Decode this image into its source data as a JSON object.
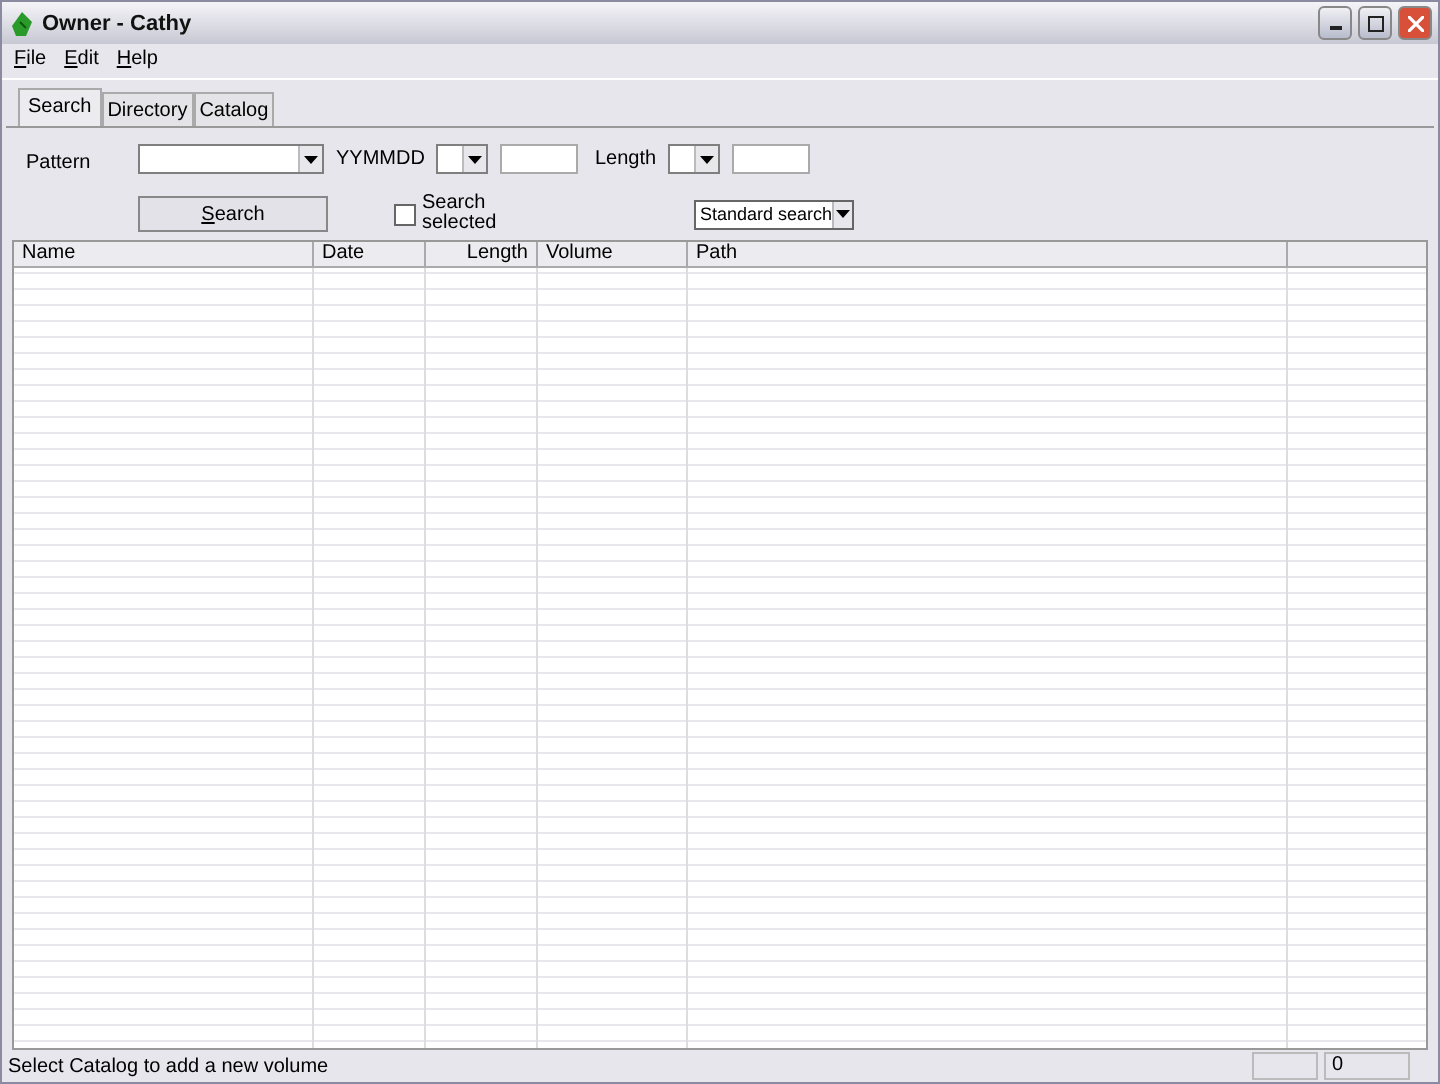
{
  "window": {
    "title": "Owner - Cathy"
  },
  "menu": [
    "File",
    "Edit",
    "Help"
  ],
  "tabs": [
    {
      "label": "Search",
      "selected": true
    },
    {
      "label": "Directory",
      "selected": false
    },
    {
      "label": "Catalog",
      "selected": false
    }
  ],
  "form": {
    "pattern_label": "Pattern",
    "date_label": "YYMMDD",
    "length_label": "Length",
    "search_button": "Search",
    "search_selected": {
      "label": "Search selected",
      "checked": false
    },
    "mode": "Standard search"
  },
  "table": {
    "columns": [
      {
        "label": "Name"
      },
      {
        "label": "Date"
      },
      {
        "label": "Length"
      },
      {
        "label": "Volume"
      },
      {
        "label": "Path"
      }
    ]
  },
  "status_bar": {
    "message": "Select Catalog to add a new volume",
    "count": "0"
  }
}
